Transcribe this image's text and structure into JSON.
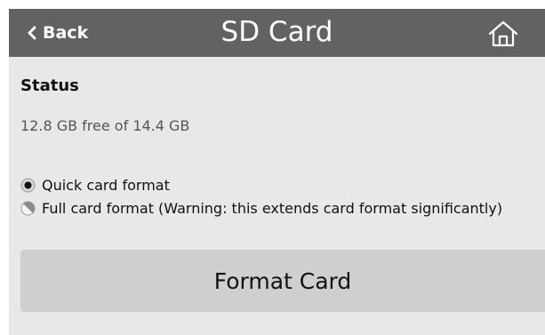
{
  "header": {
    "back_label": "Back",
    "title": "SD Card",
    "back_icon": "chevron-left-icon",
    "home_icon": "home-icon"
  },
  "status": {
    "heading": "Status",
    "storage": "12.8 GB free of 14.4 GB"
  },
  "format_options": [
    {
      "label": "Quick card format",
      "selected": true
    },
    {
      "label": "Full card format (Warning: this extends card format significantly)",
      "selected": false
    }
  ],
  "format_button": {
    "label": "Format Card"
  },
  "colors": {
    "header_bg": "#626262",
    "content_bg": "#e8e8e8",
    "button_bg": "#cfcfcf"
  }
}
